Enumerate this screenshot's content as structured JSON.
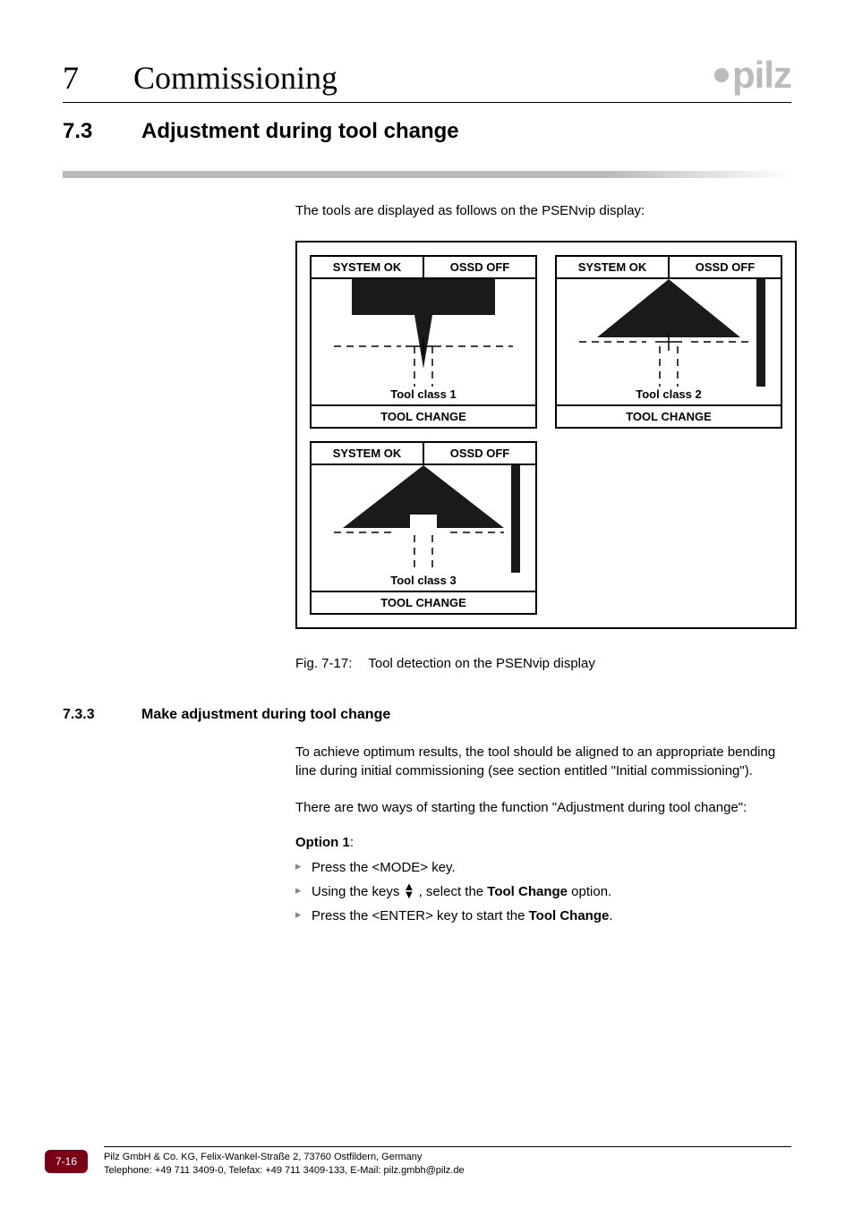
{
  "header": {
    "chapter_number": "7",
    "chapter_title": "Commissioning",
    "logo_text": "pilz"
  },
  "section": {
    "number": "7.3",
    "title": "Adjustment during tool change"
  },
  "intro_text": "The tools are displayed as follows on the PSENvip display:",
  "figure": {
    "panels": [
      {
        "status_left": "SYSTEM OK",
        "status_right": "OSSD OFF",
        "tool_class": "Tool class 1",
        "footer": "TOOL CHANGE"
      },
      {
        "status_left": "SYSTEM OK",
        "status_right": "OSSD OFF",
        "tool_class": "Tool class 2",
        "footer": "TOOL CHANGE"
      },
      {
        "status_left": "SYSTEM OK",
        "status_right": "OSSD OFF",
        "tool_class": "Tool class 3",
        "footer": "TOOL CHANGE"
      }
    ],
    "caption_num": "Fig. 7-17:",
    "caption_text": "Tool detection on the PSENvip display"
  },
  "subsection": {
    "number": "7.3.3",
    "title": "Make adjustment during tool change"
  },
  "para1": "To achieve optimum results, the tool should be aligned to an appropriate bending line during initial commissioning (see section entitled \"Initial commissioning\").",
  "para2": "There are two ways of starting the function \"Adjustment during tool change\":",
  "option1": {
    "label_bold": "Option 1",
    "label_suffix": ":",
    "bullet1": "Press the <MODE> key.",
    "bullet2_pre": "Using the keys ",
    "bullet2_mid": " , select the ",
    "bullet2_bold": "Tool Change",
    "bullet2_post": " option.",
    "bullet3_pre": "Press the <ENTER> key to start the ",
    "bullet3_bold": "Tool Change",
    "bullet3_post": "."
  },
  "footer": {
    "page_num": "7-16",
    "line1": "Pilz GmbH & Co. KG, Felix-Wankel-Straße 2, 73760 Ostfildern, Germany",
    "line2": "Telephone: +49 711 3409-0, Telefax: +49 711 3409-133, E-Mail: pilz.gmbh@pilz.de"
  }
}
